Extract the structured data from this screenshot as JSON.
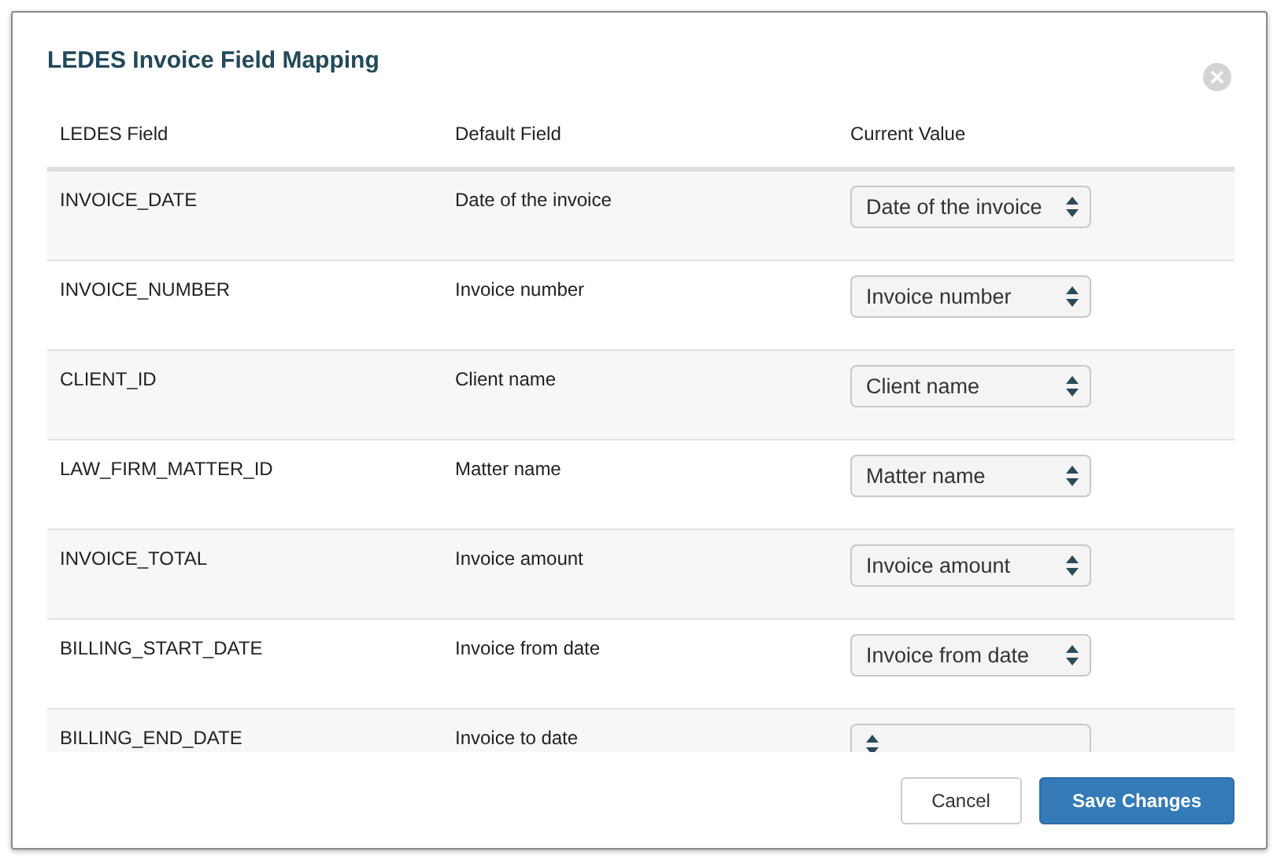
{
  "dialog": {
    "title": "LEDES Invoice Field Mapping"
  },
  "table": {
    "columns": [
      "LEDES Field",
      "Default Field",
      "Current Value"
    ],
    "rows": [
      {
        "ledes_field": "INVOICE_DATE",
        "default_field": "Date of the invoice",
        "current_value": "Date of the invoice"
      },
      {
        "ledes_field": "INVOICE_NUMBER",
        "default_field": "Invoice number",
        "current_value": "Invoice number"
      },
      {
        "ledes_field": "CLIENT_ID",
        "default_field": "Client name",
        "current_value": "Client name"
      },
      {
        "ledes_field": "LAW_FIRM_MATTER_ID",
        "default_field": "Matter name",
        "current_value": "Matter name"
      },
      {
        "ledes_field": "INVOICE_TOTAL",
        "default_field": "Invoice amount",
        "current_value": "Invoice amount"
      },
      {
        "ledes_field": "BILLING_START_DATE",
        "default_field": "Invoice from date",
        "current_value": "Invoice from date"
      },
      {
        "ledes_field": "BILLING_END_DATE",
        "default_field": "Invoice to date"
      }
    ]
  },
  "buttons": [
    {
      "label": "Cancel",
      "kind": "secondary"
    },
    {
      "label": "Save Changes",
      "kind": "primary"
    }
  ]
}
